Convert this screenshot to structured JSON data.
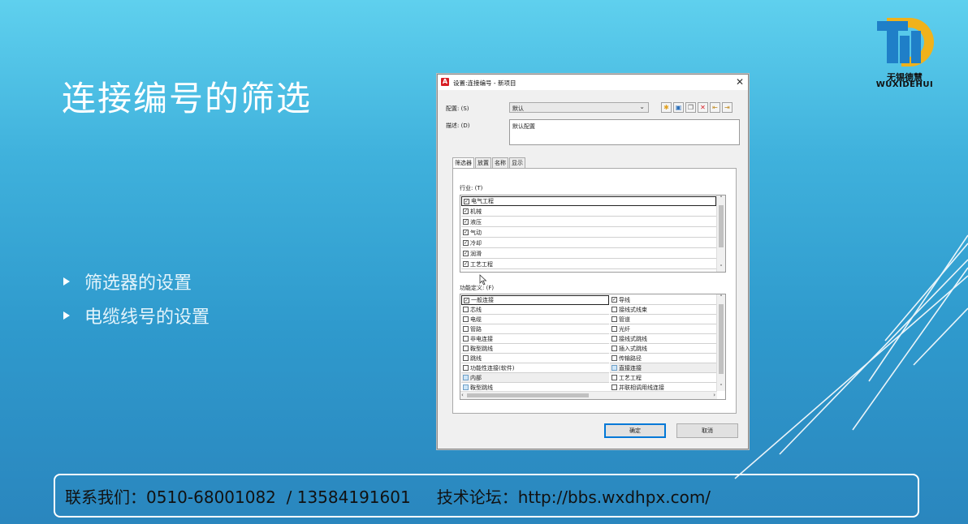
{
  "slide": {
    "title": "连接编号的筛选",
    "bullets": [
      "筛选器的设置",
      "电缆线号的设置"
    ],
    "footer": {
      "contact": "联系我们：0510-68001082  / 13584191601",
      "forum": "技术论坛：http://bbs.wxdhpx.com/"
    }
  },
  "logo": {
    "cn": "无锡德慧",
    "en": "WUXIDEHUI"
  },
  "dialog": {
    "title": "设置:连接编号 - 新项目",
    "config_label": "配置: (S)",
    "config_value": "默认",
    "desc_label": "描述: (D)",
    "desc_value": "默认配置",
    "tabs": [
      "筛选器",
      "放置",
      "名称",
      "显示"
    ],
    "industry_label": "行业: (T)",
    "industries": [
      {
        "label": "电气工程",
        "checked": true
      },
      {
        "label": "机械",
        "checked": true
      },
      {
        "label": "液压",
        "checked": true
      },
      {
        "label": "气动",
        "checked": true
      },
      {
        "label": "冷却",
        "checked": true
      },
      {
        "label": "润滑",
        "checked": true
      },
      {
        "label": "工艺工程",
        "checked": true
      }
    ],
    "function_label": "功能定义: (F)",
    "functions_left": [
      {
        "label": "一般连接",
        "checked": true
      },
      {
        "label": "芯线",
        "checked": false
      },
      {
        "label": "电缆",
        "checked": false
      },
      {
        "label": "管路",
        "checked": false
      },
      {
        "label": "非电连接",
        "checked": false
      },
      {
        "label": "鞍型跳线",
        "checked": false
      },
      {
        "label": "跳线",
        "checked": false
      },
      {
        "label": "功能性连接(软件)",
        "checked": false
      },
      {
        "label": "内部",
        "checked": false
      },
      {
        "label": "鞍型跳线",
        "checked": false
      }
    ],
    "functions_right": [
      {
        "label": "导线",
        "checked": true
      },
      {
        "label": "接线式线束",
        "checked": false
      },
      {
        "label": "管道",
        "checked": false
      },
      {
        "label": "光纤",
        "checked": false
      },
      {
        "label": "接线式跳线",
        "checked": false
      },
      {
        "label": "插入式跳线",
        "checked": false
      },
      {
        "label": "传输路径",
        "checked": false
      },
      {
        "label": "直接连接",
        "checked": false
      },
      {
        "label": "工艺工程",
        "checked": false
      },
      {
        "label": "并联相调用线连接",
        "checked": false
      }
    ],
    "ok_label": "确定",
    "cancel_label": "取消"
  },
  "colors": {
    "accent_red": "#d81f26",
    "focus_blue": "#0078d7"
  }
}
